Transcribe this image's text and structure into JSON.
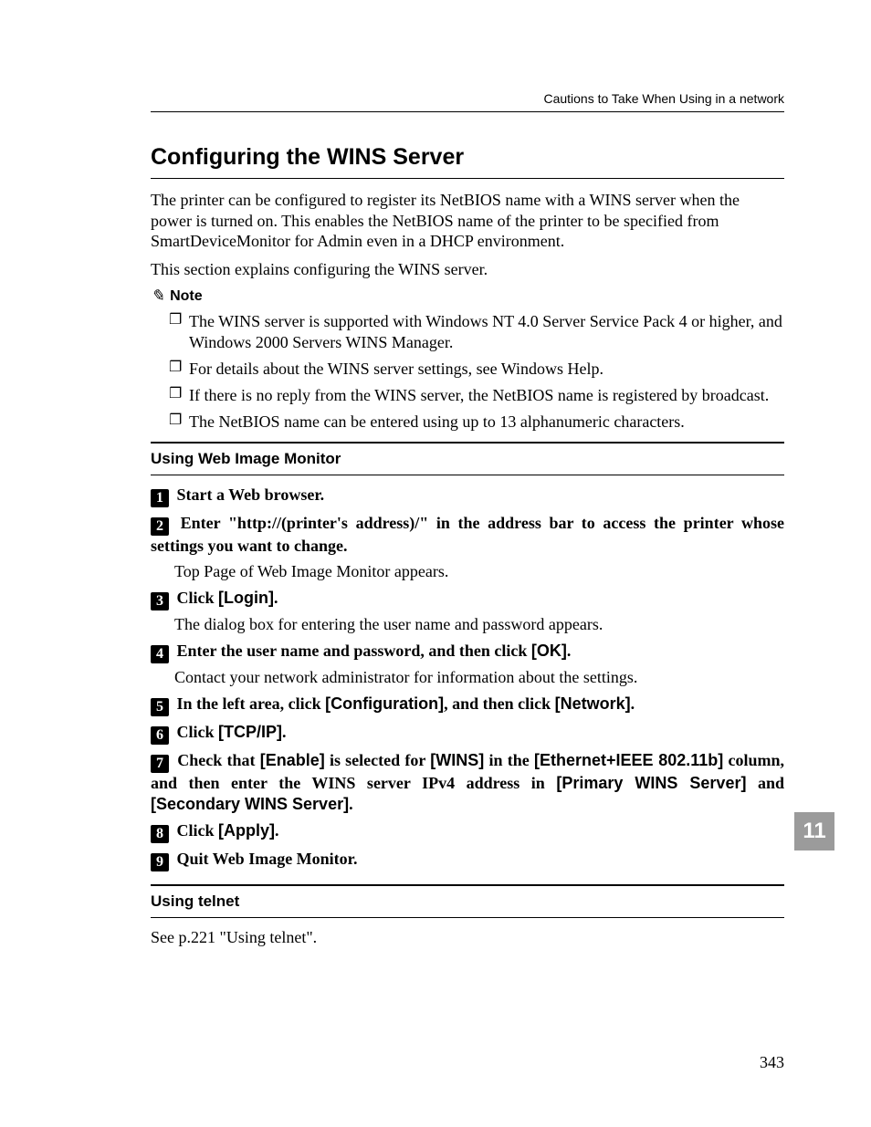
{
  "running_head": "Cautions to Take When Using in a network",
  "section_title": "Configuring the WINS Server",
  "intro_p1": "The printer can be configured to register its NetBIOS name with a WINS server when the power is turned on. This enables the NetBIOS name of the printer to be specified from SmartDeviceMonitor for Admin even in a DHCP environment.",
  "intro_p2": "This section explains configuring the WINS server.",
  "note_label": "Note",
  "notes": [
    "The WINS server is supported with Windows NT 4.0 Server Service Pack 4 or higher, and Windows 2000 Servers WINS Manager.",
    "For details about the WINS server settings, see Windows Help.",
    "If there is no reply from the WINS server, the NetBIOS name is registered by broadcast.",
    "The NetBIOS name can be entered using up to 13 alphanumeric characters."
  ],
  "sub1_title": "Using Web Image Monitor",
  "steps": {
    "s1": "Start a Web browser.",
    "s2": "Enter \"http://(printer's address)/\" in the address bar to access the printer whose settings you want to change.",
    "s2_body": "Top Page of Web Image Monitor appears.",
    "s3_a": "Click ",
    "s3_b": "[Login]",
    "s3_c": ".",
    "s3_body": "The dialog box for entering the user name and password appears.",
    "s4_a": "Enter the user name and password, and then click ",
    "s4_b": "[OK]",
    "s4_c": ".",
    "s4_body": "Contact your network administrator for information about the settings.",
    "s5_a": "In the left area, click ",
    "s5_b": "[Configuration]",
    "s5_c": ", and then click ",
    "s5_d": "[Network]",
    "s5_e": ".",
    "s6_a": "Click ",
    "s6_b": "[TCP/IP]",
    "s6_c": ".",
    "s7_a": "Check that ",
    "s7_b": "[Enable]",
    "s7_c": " is selected for ",
    "s7_d": "[WINS]",
    "s7_e": " in the ",
    "s7_f": "[Ethernet+IEEE 802.11b]",
    "s7_g": " column, and then enter the WINS server IPv4 address in ",
    "s7_h": "[Primary WINS Server]",
    "s7_i": " and ",
    "s7_j": "[Secondary WINS Server]",
    "s7_k": ".",
    "s8_a": "Click ",
    "s8_b": "[Apply]",
    "s8_c": ".",
    "s9": "Quit Web Image Monitor."
  },
  "sub2_title": "Using telnet",
  "sub2_body": "See p.221 \"Using telnet\".",
  "chapter_tab": "11",
  "page_number": "343"
}
